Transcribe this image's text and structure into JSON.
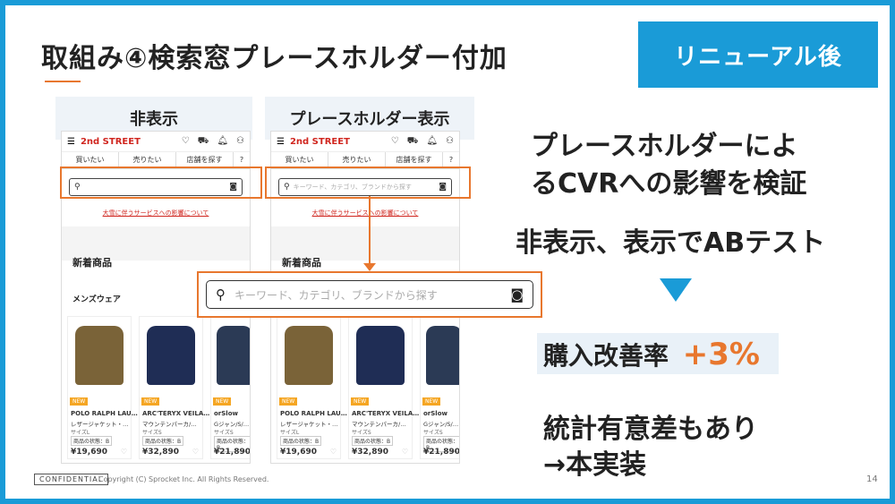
{
  "slide": {
    "title": "取組み④検索窓プレースホルダー付加",
    "badge": "リニューアル後",
    "tab_hidden": "非表示",
    "tab_shown": "プレースホルダー表示",
    "page_number": "14",
    "confidential": "CONFIDENTIAL",
    "copyright": "Copyright (C) Sprocket Inc. All Rights Reserved."
  },
  "phone": {
    "logo": "2nd STREET",
    "nav": [
      "買いたい",
      "売りたい",
      "店舗を探す",
      "?"
    ],
    "placeholder": "キーワード、カテゴリ、ブランドから探す",
    "notice_link": "大雪に伴うサービスへの影響について",
    "section_new": "新着商品",
    "section_mens": "メンズウェア",
    "cards": [
      {
        "brand": "POLO RALPH LAU…",
        "sub": "レザージャケット・…",
        "size": "サイズL",
        "cond": "商品の状態：B",
        "price": "¥19,690",
        "color": "#7a6338",
        "new": "NEW"
      },
      {
        "brand": "ARC'TERYX VEILA…",
        "sub": "マウンテンパーカ/…",
        "size": "サイズS",
        "cond": "商品の状態：B",
        "price": "¥32,890",
        "color": "#1f2d55",
        "new": "NEW"
      },
      {
        "brand": "orSlow",
        "sub": "Gジャン/S/…",
        "size": "サイズS",
        "cond": "商品の状態：B",
        "price": "¥21,890",
        "color": "#2b3a55",
        "new": "NEW"
      }
    ]
  },
  "zoom": {
    "placeholder": "キーワード、カテゴリ、ブランドから探す"
  },
  "right": {
    "line1": "プレースホルダーによ",
    "line2": "るCVRへの影響を検証",
    "line3": "非表示、表示でABテスト",
    "result_label": "購入改善率",
    "result_value": "+3%",
    "line5": "統計有意差もあり",
    "line6": "→本実装"
  },
  "colors": {
    "accent_blue": "#1a9bd7",
    "accent_orange": "#e8772e"
  }
}
